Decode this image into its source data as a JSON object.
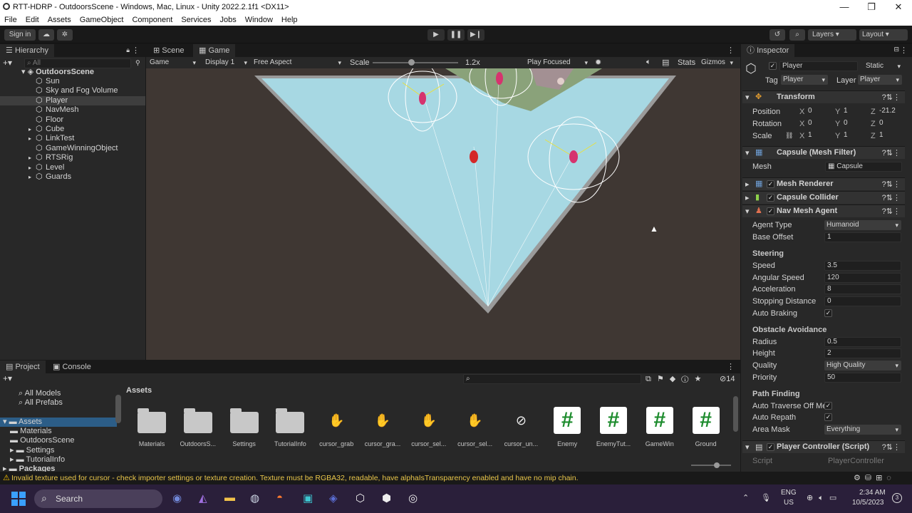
{
  "window": {
    "title": "RTT-HDRP - OutdoorsScene - Windows, Mac, Linux - Unity 2022.2.1f1 <DX11>",
    "minimize": "—",
    "maximize": "❐",
    "close": "✕"
  },
  "menu": [
    "File",
    "Edit",
    "Assets",
    "GameObject",
    "Component",
    "Services",
    "Jobs",
    "Window",
    "Help"
  ],
  "toolbar": {
    "sign_in": "Sign in",
    "layers": "Layers",
    "layout": "Layout"
  },
  "hierarchy": {
    "tab": "Hierarchy",
    "search_placeholder": "All",
    "scene": "OutdoorsScene",
    "items": [
      {
        "label": "Sun",
        "expand": false,
        "selected": false
      },
      {
        "label": "Sky and Fog Volume",
        "expand": false,
        "selected": false
      },
      {
        "label": "Player",
        "expand": false,
        "selected": true
      },
      {
        "label": "NavMesh",
        "expand": false,
        "selected": false
      },
      {
        "label": "Floor",
        "expand": false,
        "selected": false
      },
      {
        "label": "Cube",
        "expand": true,
        "selected": false
      },
      {
        "label": "LinkTest",
        "expand": true,
        "selected": false
      },
      {
        "label": "GameWinningObject",
        "expand": false,
        "selected": false
      },
      {
        "label": "RTSRig",
        "expand": true,
        "selected": false
      },
      {
        "label": "Level",
        "expand": true,
        "selected": false
      },
      {
        "label": "Guards",
        "expand": true,
        "selected": false
      }
    ]
  },
  "game_view": {
    "tabs": {
      "scene": "Scene",
      "game": "Game"
    },
    "display_mode": "Game",
    "display": "Display 1",
    "aspect": "Free Aspect",
    "scale_label": "Scale",
    "scale_value": "1.2x",
    "play_mode": "Play Focused",
    "stats": "Stats",
    "gizmos": "Gizmos",
    "scale_fraction": 0.45
  },
  "inspector": {
    "tab": "Inspector",
    "object_name": "Player",
    "static_label": "Static",
    "tag_label": "Tag",
    "tag_value": "Player",
    "layer_label": "Layer",
    "layer_value": "Player",
    "transform": {
      "title": "Transform",
      "position": {
        "label": "Position",
        "x": "0",
        "y": "1",
        "z": "-21.2"
      },
      "rotation": {
        "label": "Rotation",
        "x": "0",
        "y": "0",
        "z": "0"
      },
      "scale": {
        "label": "Scale",
        "x": "1",
        "y": "1",
        "z": "1"
      }
    },
    "mesh_filter": {
      "title": "Capsule (Mesh Filter)",
      "mesh_label": "Mesh",
      "mesh_value": "Capsule"
    },
    "mesh_renderer": "Mesh Renderer",
    "capsule_collider": "Capsule Collider",
    "nav_agent": {
      "title": "Nav Mesh Agent",
      "agent_type_label": "Agent Type",
      "agent_type": "Humanoid",
      "base_offset_label": "Base Offset",
      "base_offset": "1",
      "steering": "Steering",
      "speed_label": "Speed",
      "speed": "3.5",
      "angular_speed_label": "Angular Speed",
      "angular_speed": "120",
      "acceleration_label": "Acceleration",
      "acceleration": "8",
      "stopping_label": "Stopping Distance",
      "stopping": "0",
      "auto_braking_label": "Auto Braking",
      "obstacle": "Obstacle Avoidance",
      "radius_label": "Radius",
      "radius": "0.5",
      "height_label": "Height",
      "height": "2",
      "quality_label": "Quality",
      "quality": "High Quality",
      "priority_label": "Priority",
      "priority": "50",
      "pathfinding": "Path Finding",
      "auto_traverse_label": "Auto Traverse Off Me",
      "auto_repath_label": "Auto Repath",
      "area_mask_label": "Area Mask",
      "area_mask": "Everything"
    },
    "player_controller": "Player Controller (Script)",
    "script_label": "Script",
    "script_value": "PlayerController"
  },
  "project": {
    "tabs": {
      "project": "Project",
      "console": "Console"
    },
    "favorites": [
      "All Models",
      "All Prefabs"
    ],
    "tree": [
      "Assets",
      "Materials",
      "OutdoorsScene",
      "Settings",
      "TutorialInfo",
      "Packages"
    ],
    "breadcrumb": "Assets",
    "count": "14",
    "assets": [
      {
        "label": "Materials",
        "kind": "folder"
      },
      {
        "label": "OutdoorsS...",
        "kind": "folder"
      },
      {
        "label": "Settings",
        "kind": "folder"
      },
      {
        "label": "TutorialInfo",
        "kind": "folder"
      },
      {
        "label": "cursor_grab",
        "kind": "cursor"
      },
      {
        "label": "cursor_gra...",
        "kind": "cursor"
      },
      {
        "label": "cursor_sel...",
        "kind": "cursor"
      },
      {
        "label": "cursor_sel...",
        "kind": "cursor"
      },
      {
        "label": "cursor_un...",
        "kind": "cursor"
      },
      {
        "label": "Enemy",
        "kind": "script"
      },
      {
        "label": "EnemyTut...",
        "kind": "script"
      },
      {
        "label": "GameWin",
        "kind": "script"
      },
      {
        "label": "Ground",
        "kind": "script"
      }
    ]
  },
  "status": {
    "message": "Invalid texture used for cursor - check importer settings or texture creation. Texture must be RGBA32, readable, have alphaIsTransparency enabled and have no mip chain."
  },
  "taskbar": {
    "search": "Search",
    "lang1": "ENG",
    "lang2": "US",
    "time": "2:34 AM",
    "date": "10/5/2023",
    "notif": "3"
  },
  "colors": {
    "accent": "#3a79bb",
    "select": "#2c5d87",
    "warning": "#f5c000"
  }
}
